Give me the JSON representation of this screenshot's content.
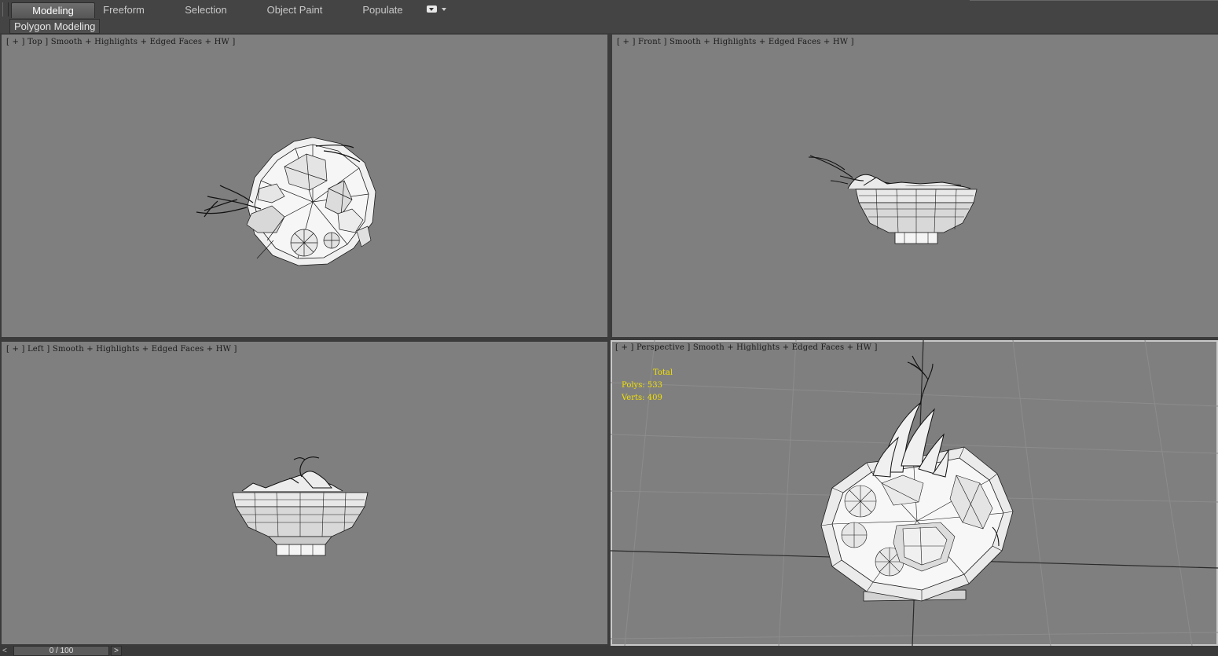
{
  "ribbon": {
    "tabs": [
      {
        "label": "Modeling",
        "active": true
      },
      {
        "label": "Freeform",
        "active": false
      },
      {
        "label": "Selection",
        "active": false
      },
      {
        "label": "Object Paint",
        "active": false
      },
      {
        "label": "Populate",
        "active": false
      }
    ],
    "options_icon": "ribbon-options-icon",
    "panel_label": "Polygon Modeling"
  },
  "viewports": {
    "top": {
      "menu_plus": "+",
      "name": "Top",
      "shading": "Smooth + Highlights + Edged Faces + HW"
    },
    "front": {
      "menu_plus": "+",
      "name": "Front",
      "shading": "Smooth + Highlights + Edged Faces + HW"
    },
    "left": {
      "menu_plus": "+",
      "name": "Left",
      "shading": "Smooth + Highlights + Edged Faces + HW"
    },
    "perspective": {
      "menu_plus": "+",
      "name": "Perspective",
      "shading": "Smooth + Highlights + Edged Faces + HW",
      "stats": {
        "title": "Total",
        "polys_label": "Polys:",
        "polys_value": "533",
        "verts_label": "Verts:",
        "verts_value": "409"
      }
    }
  },
  "timeline": {
    "prev": "<",
    "position": "0 / 100",
    "next": ">"
  },
  "colors": {
    "viewport_bg": "#7f7f7f",
    "stats_text": "#f2e000",
    "ui_bg": "#444444"
  }
}
